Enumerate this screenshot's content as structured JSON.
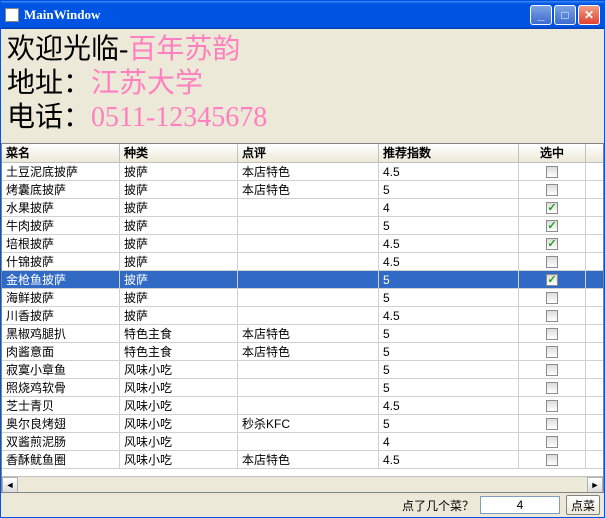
{
  "window": {
    "title": "MainWindow"
  },
  "header": {
    "welcome_black": "欢迎光临-",
    "welcome_pink": "百年苏韵",
    "addr_black": "地址：",
    "addr_pink": "江苏大学",
    "tel_black": "电话：",
    "tel_pink": "0511-12345678"
  },
  "columns": {
    "c1": "菜名",
    "c2": "种类",
    "c3": "点评",
    "c4": "推荐指数",
    "c5": "选中"
  },
  "rows": [
    {
      "name": "土豆泥底披萨",
      "cat": "披萨",
      "note": "本店特色",
      "rate": "4.5",
      "checked": false,
      "sel": false
    },
    {
      "name": "烤囊底披萨",
      "cat": "披萨",
      "note": "本店特色",
      "rate": "5",
      "checked": false,
      "sel": false
    },
    {
      "name": "水果披萨",
      "cat": "披萨",
      "note": "",
      "rate": "4",
      "checked": true,
      "sel": false
    },
    {
      "name": "牛肉披萨",
      "cat": "披萨",
      "note": "",
      "rate": "5",
      "checked": true,
      "sel": false
    },
    {
      "name": "培根披萨",
      "cat": "披萨",
      "note": "",
      "rate": "4.5",
      "checked": true,
      "sel": false
    },
    {
      "name": "什锦披萨",
      "cat": "披萨",
      "note": "",
      "rate": "4.5",
      "checked": false,
      "sel": false
    },
    {
      "name": "金枪鱼披萨",
      "cat": "披萨",
      "note": "",
      "rate": "5",
      "checked": true,
      "sel": true
    },
    {
      "name": "海鲜披萨",
      "cat": "披萨",
      "note": "",
      "rate": "5",
      "checked": false,
      "sel": false
    },
    {
      "name": "川香披萨",
      "cat": "披萨",
      "note": "",
      "rate": "4.5",
      "checked": false,
      "sel": false
    },
    {
      "name": "黑椒鸡腿扒",
      "cat": "特色主食",
      "note": "本店特色",
      "rate": "5",
      "checked": false,
      "sel": false
    },
    {
      "name": "肉酱意面",
      "cat": "特色主食",
      "note": "本店特色",
      "rate": "5",
      "checked": false,
      "sel": false
    },
    {
      "name": "寂寞小章鱼",
      "cat": "风味小吃",
      "note": "",
      "rate": "5",
      "checked": false,
      "sel": false
    },
    {
      "name": "照烧鸡软骨",
      "cat": "风味小吃",
      "note": "",
      "rate": "5",
      "checked": false,
      "sel": false
    },
    {
      "name": "芝士青贝",
      "cat": "风味小吃",
      "note": "",
      "rate": "4.5",
      "checked": false,
      "sel": false
    },
    {
      "name": "奥尔良烤翅",
      "cat": "风味小吃",
      "note": "秒杀KFC",
      "rate": "5",
      "checked": false,
      "sel": false
    },
    {
      "name": "双酱煎泥肠",
      "cat": "风味小吃",
      "note": "",
      "rate": "4",
      "checked": false,
      "sel": false
    },
    {
      "name": "香酥鱿鱼圈",
      "cat": "风味小吃",
      "note": "本店特色",
      "rate": "4.5",
      "checked": false,
      "sel": false
    }
  ],
  "footer": {
    "label": "点了几个菜？",
    "count": "4",
    "button": "点菜"
  }
}
